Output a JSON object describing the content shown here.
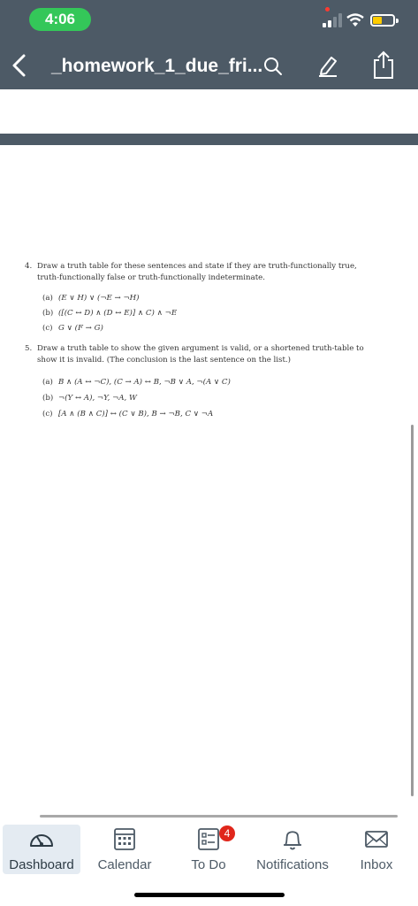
{
  "status_bar": {
    "time": "4:06"
  },
  "nav": {
    "title": "_homework_1_due_fri..."
  },
  "document": {
    "q4": {
      "number": "4.",
      "line1": "Draw a truth table for these sentences and state if they are truth-functionally true,",
      "line2": "truth-functionally false or truth-functionally indeterminate.",
      "items": [
        {
          "label": "(a)",
          "text": "(E ∨ H) ∨ (¬E → ¬H)"
        },
        {
          "label": "(b)",
          "text": "([(C ↔ D) ∧ (D ↔ E)] ∧ C) ∧ ¬E"
        },
        {
          "label": "(c)",
          "text": "G ∨ (F → G)"
        }
      ]
    },
    "q5": {
      "number": "5.",
      "line1": "Draw a truth table to show the given argument is valid, or a shortened truth-table to",
      "line2": "show it is invalid. (The conclusion is the last sentence on the list.)",
      "items": [
        {
          "label": "(a)",
          "text": "B ∧ (A ↔ ¬C), (C → A) ↔ B, ¬B ∨ A, ¬(A ∨ C)"
        },
        {
          "label": "(b)",
          "text": "¬(Y ↔ A), ¬Y, ¬A, W"
        },
        {
          "label": "(c)",
          "text": "[A ∧ (B ∧ C)] ↔ (C ∨ B), B → ¬B, C ∨ ¬A"
        }
      ]
    }
  },
  "tabbar": {
    "tabs": [
      {
        "label": "Dashboard",
        "icon": "speedometer-icon",
        "active": true
      },
      {
        "label": "Calendar",
        "icon": "calendar-icon"
      },
      {
        "label": "To Do",
        "icon": "todo-icon",
        "badge": "4"
      },
      {
        "label": "Notifications",
        "icon": "bell-icon"
      },
      {
        "label": "Inbox",
        "icon": "envelope-icon"
      }
    ]
  },
  "colors": {
    "header_bg": "#4d5a66",
    "time_pill": "#34c759",
    "battery": "#ffcc00",
    "badge": "#e0261b",
    "active_tab_bg": "#e4ebf2"
  }
}
